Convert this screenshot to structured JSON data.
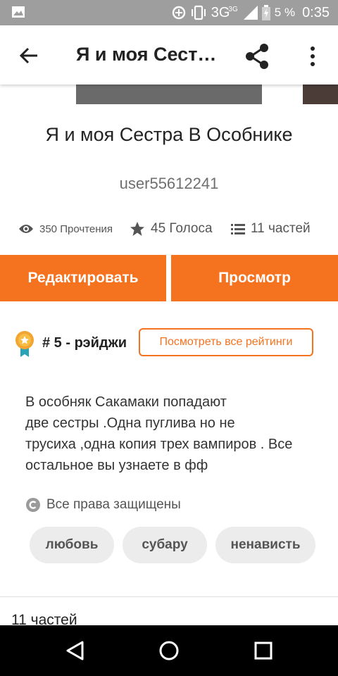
{
  "status_bar": {
    "network": "3G",
    "network_sup": "3G",
    "battery": "5 %",
    "time": "0:35"
  },
  "toolbar": {
    "title": "Я и моя Сестра В Особнике",
    "back_icon": "arrow-back-icon",
    "share_icon": "share-icon",
    "more_icon": "more-vert-icon"
  },
  "story": {
    "title": "Я и моя Сестра В Особнике",
    "author": "user55612241",
    "stats": {
      "reads": "350 Прочтения",
      "votes": "45 Голоса",
      "parts": "11 частей"
    },
    "description": "В особняк Сакамаки попадают\nдве сестры .Одна пуглива но не\nтрусиха ,одна копия трех вампиров . Все\nостальное вы узнаете в фф",
    "rights": "Все права защищены",
    "tags": [
      "любовь",
      "субару",
      "ненависть"
    ]
  },
  "actions": {
    "edit": "Редактировать",
    "view": "Просмотр"
  },
  "ranking": {
    "text": "# 5 - рэйджи",
    "button": "Посмотреть все рейтинги"
  },
  "parts_section": {
    "heading": "11 частей"
  },
  "colors": {
    "accent": "#f5721f",
    "status_bar": "#9e9e9e",
    "tag_bg": "#ececec",
    "nav_bar": "#000000"
  }
}
